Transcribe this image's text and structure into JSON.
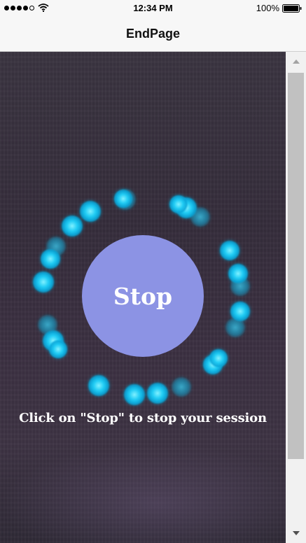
{
  "status_bar": {
    "time": "12:34 PM",
    "battery_percent": "100%",
    "signal_bars_filled": 4,
    "signal_bars_total": 5,
    "wifi_icon": "wifi-icon",
    "battery_icon": "battery-icon"
  },
  "nav": {
    "title": "EndPage"
  },
  "main": {
    "stop_label": "Stop",
    "instruction": "Click on \"Stop\" to stop your session",
    "ring_icon": "glowing-bokeh-ring"
  },
  "colors": {
    "stop_button": "#8c93e4",
    "bokeh": "#1ec8f0",
    "background": "#3a3440"
  },
  "scrollbar": {
    "up_icon": "arrow-up-icon",
    "down_icon": "arrow-down-icon"
  }
}
